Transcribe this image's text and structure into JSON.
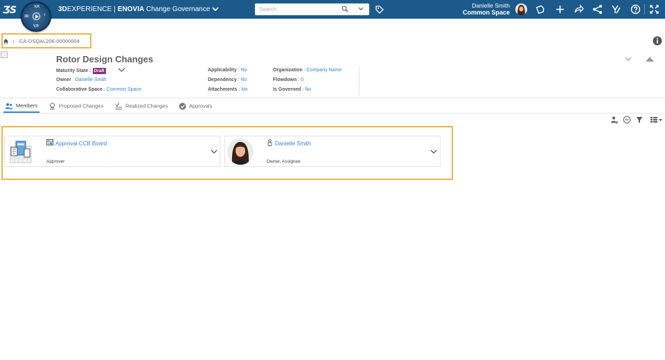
{
  "topbar": {
    "brand_3d": "3D",
    "brand_experience": "EXPERIENCE",
    "brand_sep": "|",
    "brand_enovia": "ENOVIA",
    "app_name": "Change Governance",
    "compass_labels": {
      "top": "V,R",
      "left": "3D",
      "right": "i",
      "bottom": "V,R"
    },
    "search_placeholder": "Search",
    "user_name": "Danielle Smith",
    "user_space": "Common Space",
    "accent_color": "#1b5a8a"
  },
  "breadcrumb": {
    "item": "CA-DSQAL206-00000004"
  },
  "header": {
    "title": "Rotor Design Changes",
    "maturity_label": "Maturity State",
    "maturity_value": "Draft",
    "owner_label": "Owner",
    "owner_value": "Danielle Smith",
    "space_label": "Collaborative Space",
    "space_value": "Common Space",
    "applicability_label": "Applicability",
    "applicability_value": "No",
    "dependency_label": "Dependency",
    "dependency_value": "No",
    "attachments_label": "Attachments",
    "attachments_value": "No",
    "organization_label": "Organization",
    "organization_value": "Company Name",
    "flowdown_label": "Flowdown",
    "flowdown_value": "0",
    "governed_label": "Is Governed",
    "governed_value": "No",
    "colon": ":"
  },
  "tabs": [
    {
      "label": "Members",
      "icon": "members-icon"
    },
    {
      "label": "Proposed Changes",
      "icon": "proposed-changes-icon"
    },
    {
      "label": "Realized Changes",
      "icon": "realized-changes-icon"
    },
    {
      "label": "Approvals",
      "icon": "approvals-icon"
    }
  ],
  "members": [
    {
      "name": "Approval CCB Board",
      "role": "Approver",
      "icon": "route-template-icon"
    },
    {
      "name": "Danielle Smith",
      "role": "Owner, Assignee",
      "icon": "person-icon"
    }
  ],
  "colors": {
    "link": "#3a84c4",
    "draft_badge": "#8a2f7a",
    "highlight": "#e8b650"
  }
}
